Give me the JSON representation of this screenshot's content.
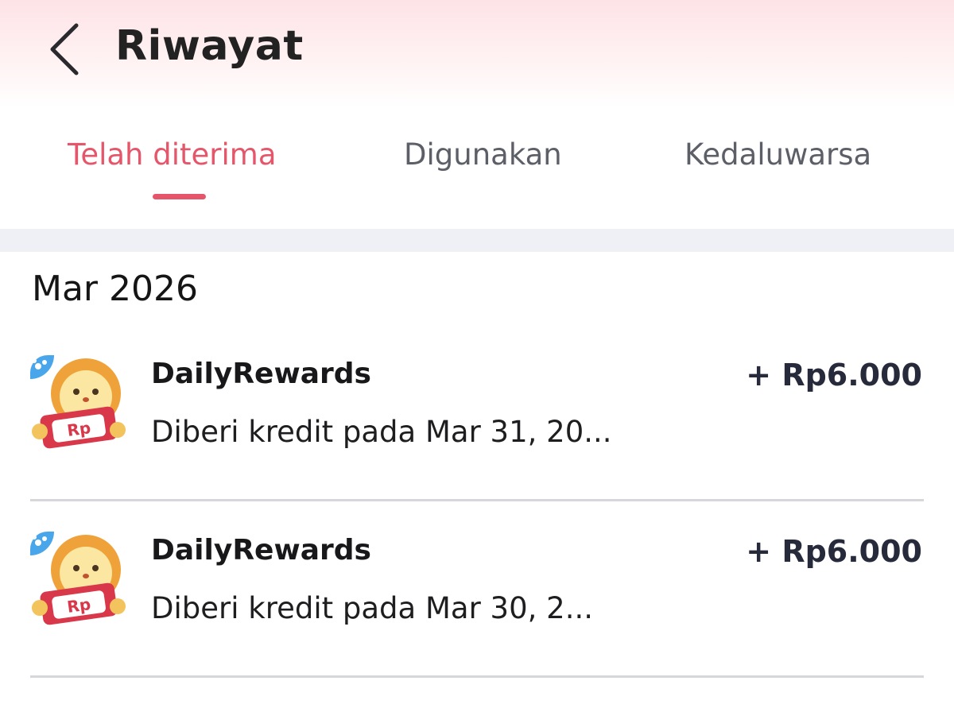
{
  "header": {
    "title": "Riwayat",
    "back_icon": "chevron-left-icon"
  },
  "tabs": [
    {
      "label": "Telah diterima",
      "active": true
    },
    {
      "label": "Digunakan",
      "active": false
    },
    {
      "label": "Kedaluwarsa",
      "active": false
    }
  ],
  "colors": {
    "accent": "#e5566a",
    "band": "#eef0f5"
  },
  "history": {
    "month": "Mar 2026",
    "items": [
      {
        "icon": "rewards-lion-icon",
        "icon_text": "Rp",
        "title": "DailyRewards",
        "subtitle": "Diberi kredit pada Mar 31, 20...",
        "amount": "+ Rp6.000"
      },
      {
        "icon": "rewards-lion-icon",
        "icon_text": "Rp",
        "title": "DailyRewards",
        "subtitle": "Diberi kredit pada Mar 30, 2...",
        "amount": "+ Rp6.000"
      }
    ]
  }
}
